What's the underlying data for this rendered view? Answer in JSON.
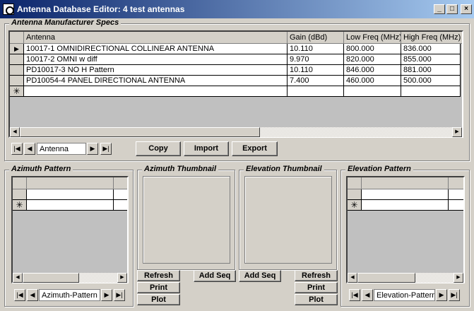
{
  "window": {
    "title": "Antenna Database Editor: 4 test antennas"
  },
  "specs": {
    "label": "Antenna Manufacturer Specs",
    "columns": [
      "Antenna",
      "Gain (dBd)",
      "Low Freq (MHz)",
      "High Freq (MHz)"
    ],
    "rows": [
      [
        "10017-1 OMNIDIRECTIONAL COLLINEAR ANTENNA",
        "10.110",
        "800.000",
        "836.000"
      ],
      [
        "10017-2 OMNI w diff",
        "9.970",
        "820.000",
        "855.000"
      ],
      [
        "PD10017-3 NO H Pattern",
        "10.110",
        "846.000",
        "881.000"
      ],
      [
        "PD10054-4 PANEL DIRECTIONAL ANTENNA",
        "7.400",
        "460.000",
        "500.000"
      ]
    ],
    "nav_field": "Antenna",
    "buttons": {
      "copy": "Copy",
      "import": "Import",
      "export": "Export"
    }
  },
  "azimuth": {
    "label": "Azimuth Pattern",
    "nav_field": "Azimuth-Pattern"
  },
  "azimuth_thumbnail": {
    "label": "Azimuth Thumbnail",
    "buttons": {
      "refresh": "Refresh",
      "print": "Print",
      "plot": "Plot",
      "add_seq": "Add Seq"
    }
  },
  "elevation_thumbnail": {
    "label": "Elevation Thumbnail",
    "buttons": {
      "refresh": "Refresh",
      "print": "Print",
      "plot": "Plot",
      "add_seq": "Add Seq"
    }
  },
  "elevation": {
    "label": "Elevation Pattern",
    "nav_field": "Elevation-Pattern"
  }
}
